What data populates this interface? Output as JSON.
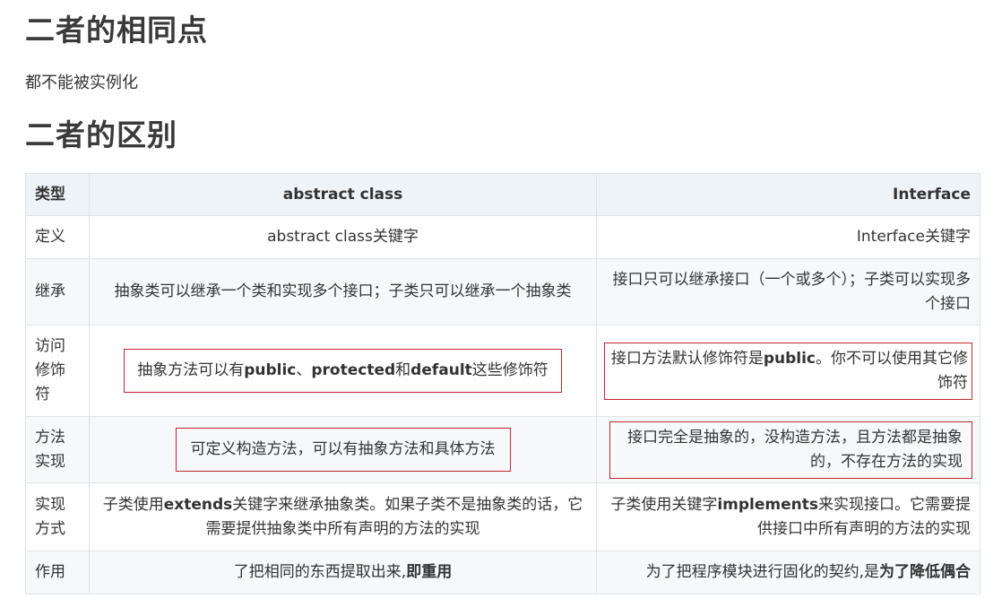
{
  "sections": {
    "same_heading": "二者的相同点",
    "same_text": "都不能被实例化",
    "diff_heading": "二者的区别"
  },
  "table": {
    "headers": [
      "类型",
      "abstract class",
      "Interface"
    ],
    "rows": [
      {
        "type": "定义",
        "abstract": "abstract class关键字",
        "interface": "Interface关键字"
      },
      {
        "type": "继承",
        "abstract": "抽象类可以继承一个类和实现多个接口；子类只可以继承一个抽象类",
        "interface": "接口只可以继承接口（一个或多个）；子类可以实现多个接口"
      },
      {
        "type": "访问修饰符",
        "abstract_pre": "抽象方法可以有",
        "abstract_b1": "public",
        "abstract_sep": "、",
        "abstract_b2": "protected",
        "abstract_and": "和",
        "abstract_b3": "default",
        "abstract_post": "这些修饰符",
        "interface_pre": "接口方法默认修饰符是",
        "interface_b": "public",
        "interface_post": "。你不可以使用其它修饰符"
      },
      {
        "type": "方法实现",
        "abstract": "可定义构造方法，可以有抽象方法和具体方法",
        "interface": "接口完全是抽象的，没构造方法，且方法都是抽象的，不存在方法的实现"
      },
      {
        "type": "实现方式",
        "abstract_pre": "子类使用",
        "abstract_b": "extends",
        "abstract_post": "关键字来继承抽象类。如果子类不是抽象类的话，它需要提供抽象类中所有声明的方法的实现",
        "interface_pre": "子类使用关键字",
        "interface_b": "implements",
        "interface_post": "来实现接口。它需要提供接口中所有声明的方法的实现"
      },
      {
        "type": "作用",
        "abstract_pre": "了把相同的东西提取出来,",
        "abstract_b": "即重用",
        "interface_pre": "为了把程序模块进行固化的契约,是",
        "interface_b": "为了降低偶合"
      }
    ]
  },
  "colors": {
    "highlight_box": "#c0272d",
    "header_bg": "#eef3f7",
    "border": "#dfe2e5"
  }
}
